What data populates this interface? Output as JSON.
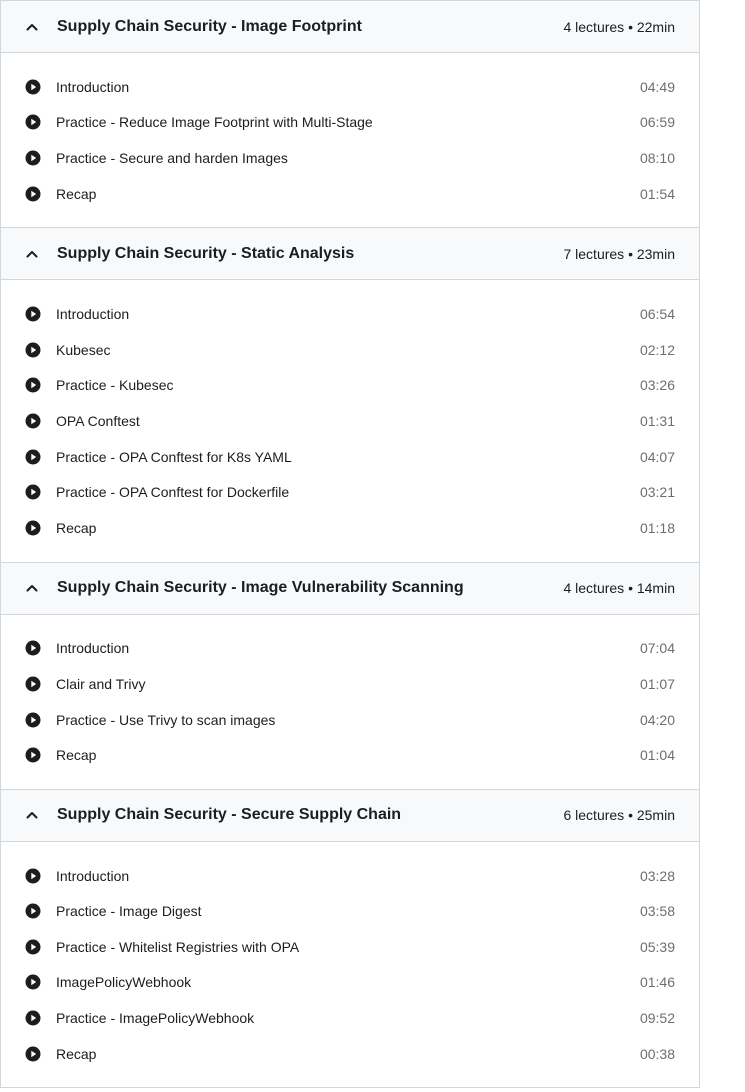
{
  "sections": [
    {
      "title": "Supply Chain Security - Image Footprint",
      "meta": "4 lectures • 22min",
      "lectures": [
        {
          "title": "Introduction",
          "duration": "04:49"
        },
        {
          "title": "Practice - Reduce Image Footprint with Multi-Stage",
          "duration": "06:59"
        },
        {
          "title": "Practice - Secure and harden Images",
          "duration": "08:10"
        },
        {
          "title": "Recap",
          "duration": "01:54"
        }
      ]
    },
    {
      "title": "Supply Chain Security - Static Analysis",
      "meta": "7 lectures • 23min",
      "lectures": [
        {
          "title": "Introduction",
          "duration": "06:54"
        },
        {
          "title": "Kubesec",
          "duration": "02:12"
        },
        {
          "title": "Practice - Kubesec",
          "duration": "03:26"
        },
        {
          "title": "OPA Conftest",
          "duration": "01:31"
        },
        {
          "title": "Practice - OPA Conftest for K8s YAML",
          "duration": "04:07"
        },
        {
          "title": "Practice - OPA Conftest for Dockerfile",
          "duration": "03:21"
        },
        {
          "title": "Recap",
          "duration": "01:18"
        }
      ]
    },
    {
      "title": "Supply Chain Security - Image Vulnerability Scanning",
      "meta": "4 lectures • 14min",
      "lectures": [
        {
          "title": "Introduction",
          "duration": "07:04"
        },
        {
          "title": "Clair and Trivy",
          "duration": "01:07"
        },
        {
          "title": "Practice - Use Trivy to scan images",
          "duration": "04:20"
        },
        {
          "title": "Recap",
          "duration": "01:04"
        }
      ]
    },
    {
      "title": "Supply Chain Security - Secure Supply Chain",
      "meta": "6 lectures • 25min",
      "lectures": [
        {
          "title": "Introduction",
          "duration": "03:28"
        },
        {
          "title": "Practice - Image Digest",
          "duration": "03:58"
        },
        {
          "title": "Practice - Whitelist Registries with OPA",
          "duration": "05:39"
        },
        {
          "title": "ImagePolicyWebhook",
          "duration": "01:46"
        },
        {
          "title": "Practice - ImagePolicyWebhook",
          "duration": "09:52"
        },
        {
          "title": "Recap",
          "duration": "00:38"
        }
      ]
    }
  ],
  "icons": {
    "section_toggle": "chevron-up-icon",
    "lecture": "play-circle-icon"
  }
}
